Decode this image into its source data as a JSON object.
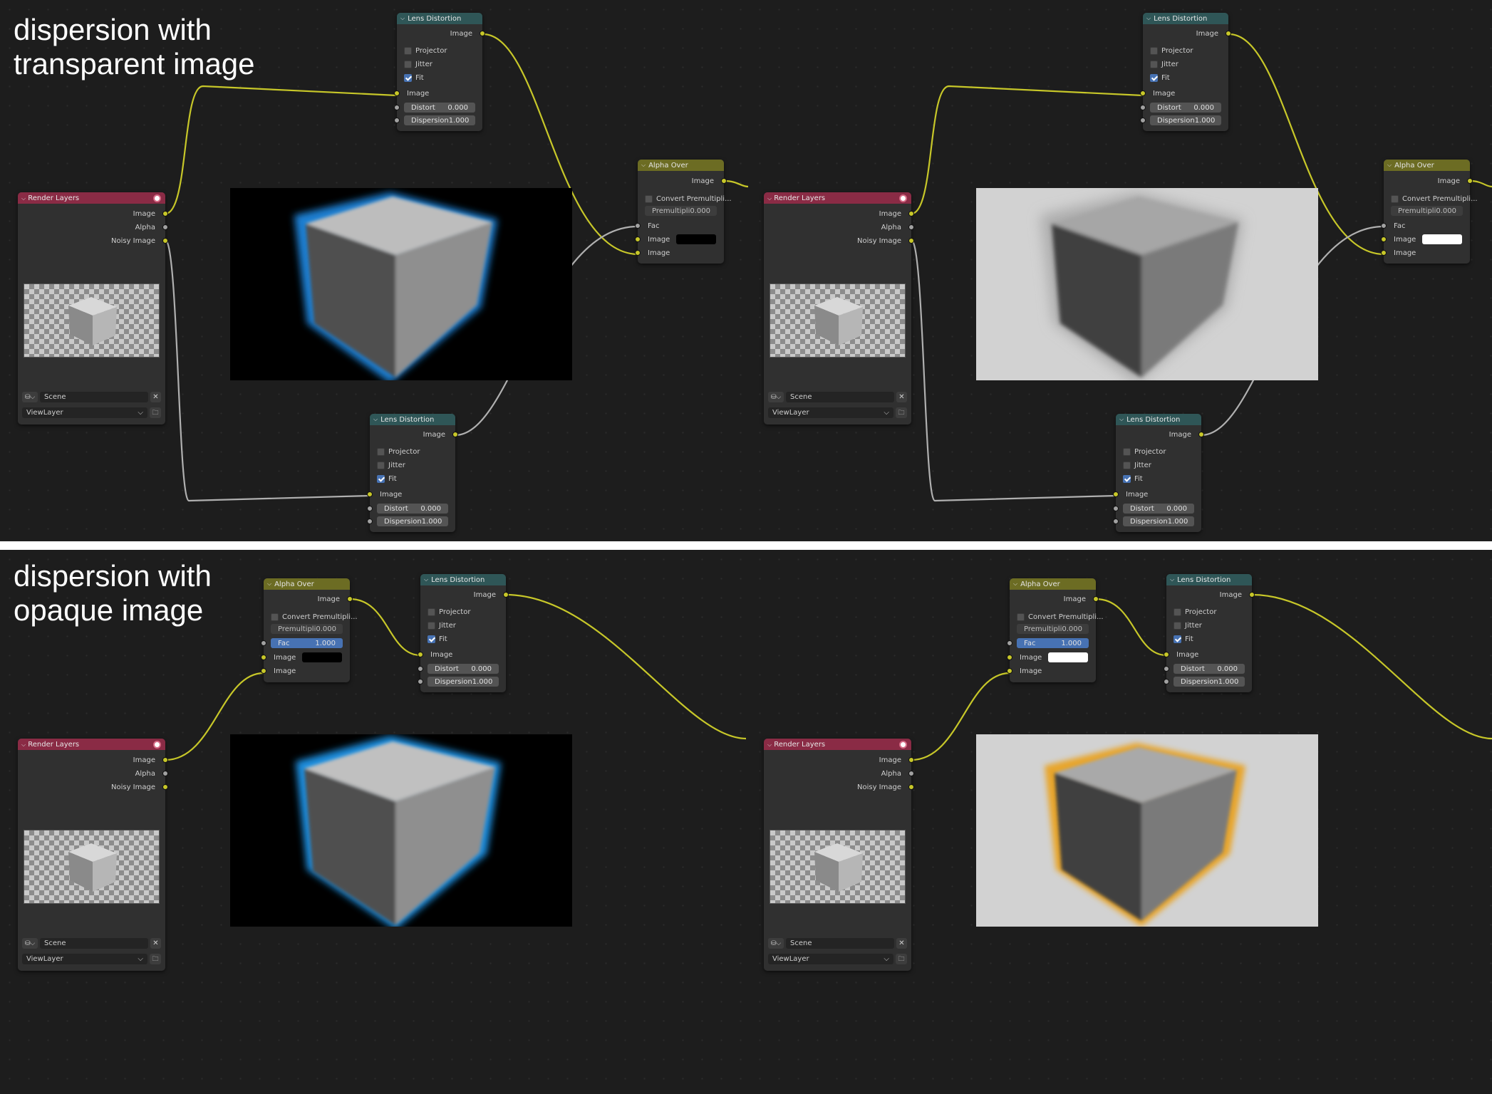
{
  "panels": [
    {
      "heading_line1": "dispersion with",
      "heading_line2": "transparent image"
    },
    {
      "heading_line1": "dispersion with",
      "heading_line2": "opaque image"
    }
  ],
  "nodes": {
    "lens_distortion": {
      "title": "Lens Distortion",
      "output_image": "Image",
      "projector": "Projector",
      "jitter": "Jitter",
      "fit": "Fit",
      "input_image": "Image",
      "distort_label": "Distort",
      "distort_value": "0.000",
      "dispersion_label": "Dispersion",
      "dispersion_value": "1.000"
    },
    "alpha_over": {
      "title": "Alpha Over",
      "output_image": "Image",
      "convert_premultiplied": "Convert Premultipli...",
      "premultiplied_label": "Premultipli",
      "premultiplied_value": "0.000",
      "fac_label": "Fac",
      "fac_value": "1.000",
      "image_label": "Image"
    },
    "render_layers": {
      "title": "Render Layers",
      "out_image": "Image",
      "out_alpha": "Alpha",
      "out_noisy": "Noisy Image",
      "scene": "Scene",
      "view_layer": "ViewLayer",
      "scene_icon": "scene-icon",
      "remove_icon": "close-icon",
      "folder_icon": "folder-icon"
    }
  },
  "colors": {
    "background": "#1d1d1d",
    "lens_header": "#2f5657",
    "alpha_header": "#6c6c23",
    "render_header": "#8a2b45",
    "socket_image": "#c7c729",
    "socket_value": "#a1a1a1",
    "checkbox_on": "#4772b3",
    "alpha_over_color_left": "#000000",
    "alpha_over_color_right": "#ffffff"
  }
}
